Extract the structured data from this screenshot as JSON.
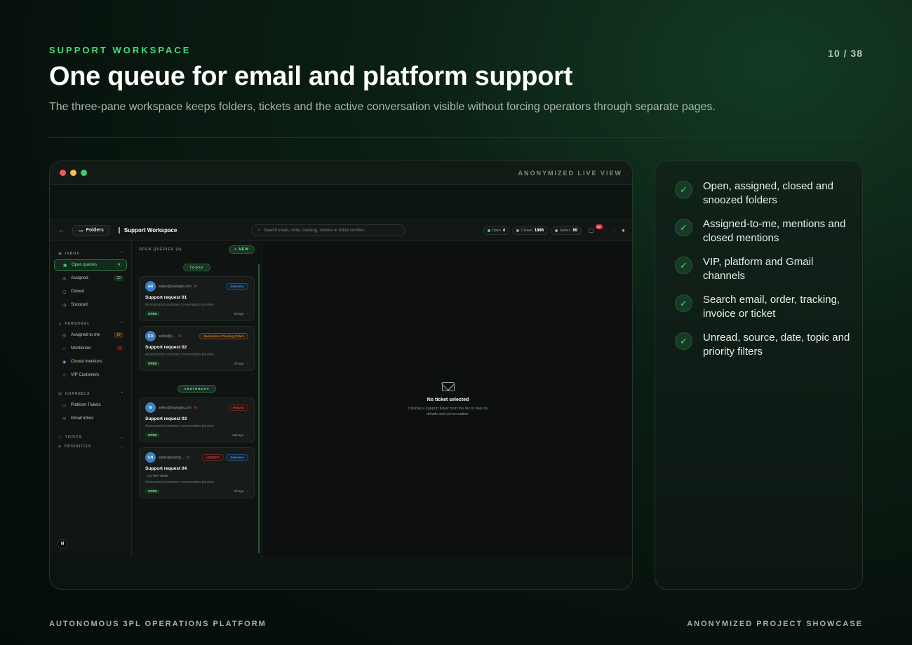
{
  "header": {
    "eyebrow": "SUPPORT WORKSPACE",
    "title": "One queue for email and platform support",
    "subtitle": "The three-pane workspace keeps folders, tickets and the active conversation visible without forcing operators through separate pages.",
    "page": "10 / 38"
  },
  "frame": {
    "label": "ANONYMIZED LIVE VIEW",
    "dot_colors": [
      "#ef5b5b",
      "#f2c14e",
      "#3ecf6a"
    ]
  },
  "app": {
    "folders_label": "Folders",
    "workspace_title": "Support Workspace",
    "search_placeholder": "Search email, order, tracking, invoice or ticket number...",
    "stats": [
      {
        "label": "Open",
        "value": "4",
        "color": "#3ee07a"
      },
      {
        "label": "Closed",
        "value": "1886",
        "color": "#9aa39d"
      },
      {
        "label": "Sellers",
        "value": "89",
        "color": "#5ab4ff"
      }
    ],
    "notif_badge": "99+",
    "sidebar": {
      "sections": [
        {
          "label": "INBOX",
          "icon": "inbox-icon",
          "items": [
            {
              "label": "Open queries",
              "count": "4",
              "active": true,
              "icon": "inbox-icon"
            },
            {
              "label": "Assigned",
              "count": "22",
              "icon": "user-icon"
            },
            {
              "label": "Closed",
              "count": "",
              "icon": "lock-icon"
            },
            {
              "label": "Snoozed",
              "count": "",
              "icon": "clock-icon"
            }
          ]
        },
        {
          "label": "PERSONAL",
          "icon": "person-icon",
          "items": [
            {
              "label": "Assigned to me",
              "count": "17",
              "icon": "user-icon"
            },
            {
              "label": "Mentioned",
              "count": "3",
              "icon": "tag-icon"
            },
            {
              "label": "Closed mentions",
              "count": "",
              "icon": "check-circle-icon"
            },
            {
              "label": "VIP Customers",
              "count": "",
              "icon": "star-icon"
            }
          ]
        },
        {
          "label": "CHANNELS",
          "icon": "channel-icon",
          "items": [
            {
              "label": "Platform Tickets",
              "count": "",
              "icon": "monitor-icon"
            },
            {
              "label": "Gmail Inbox",
              "count": "",
              "icon": "mail-icon"
            }
          ]
        },
        {
          "label": "TOPICS",
          "icon": "topic-icon",
          "items": []
        },
        {
          "label": "PRIORITIES",
          "icon": "priority-icon",
          "items": []
        }
      ],
      "avatar": "N"
    },
    "list": {
      "header": "OPEN QUERIES (4)",
      "new_label": "+ NEW",
      "groups": [
        {
          "day": "TODAY",
          "tickets": [
            {
              "initials": "AR",
              "email": "seller@example.com",
              "tags": [
                {
                  "text": "Deliveries",
                  "tone": "blue"
                }
              ],
              "title": "Support request 01",
              "ref": "",
              "preview": "Anonymized customer conversation preview",
              "status": "OPEN",
              "ago": "6d ago"
            },
            {
              "initials": "CO",
              "email": "seller@e...",
              "tags": [
                {
                  "text": "Backorders / Pending Orders",
                  "tone": "orange"
                }
              ],
              "title": "Support request 02",
              "ref": "",
              "preview": "Anonymized customer conversation preview",
              "status": "OPEN",
              "ago": "3h ago"
            }
          ]
        },
        {
          "day": "YESTERDAY",
          "tickets": [
            {
              "initials": "IN",
              "email": "seller@example.com",
              "tags": [
                {
                  "text": "Returns",
                  "tone": "red"
                }
              ],
              "title": "Support request 03",
              "ref": "",
              "preview": "Anonymized customer conversation preview",
              "status": "OPEN",
              "ago": "44d ago"
            },
            {
              "initials": "CH",
              "email": "seller@examp...",
              "tags": [
                {
                  "text": "URGENT",
                  "tone": "red"
                },
                {
                  "text": "Deliveries",
                  "tone": "blue"
                }
              ],
              "title": "Support request 04",
              "ref": "CD Ref: 48398",
              "preview": "Anonymized customer conversation preview",
              "status": "OPEN",
              "ago": "3d ago"
            }
          ]
        }
      ]
    },
    "detail": {
      "title": "No ticket selected",
      "desc": "Choose a support ticket from the list to view its details and conversation."
    }
  },
  "features": [
    "Open, assigned, closed and snoozed folders",
    "Assigned-to-me, mentions and closed mentions",
    "VIP, platform and Gmail channels",
    "Search email, order, tracking, invoice or ticket",
    "Unread, source, date, topic and priority filters"
  ],
  "footer": {
    "left": "AUTONOMOUS 3PL OPERATIONS PLATFORM",
    "right": "ANONYMIZED PROJECT SHOWCASE"
  },
  "colors": {
    "accent": "#3ee07a",
    "background": "#07120c"
  }
}
